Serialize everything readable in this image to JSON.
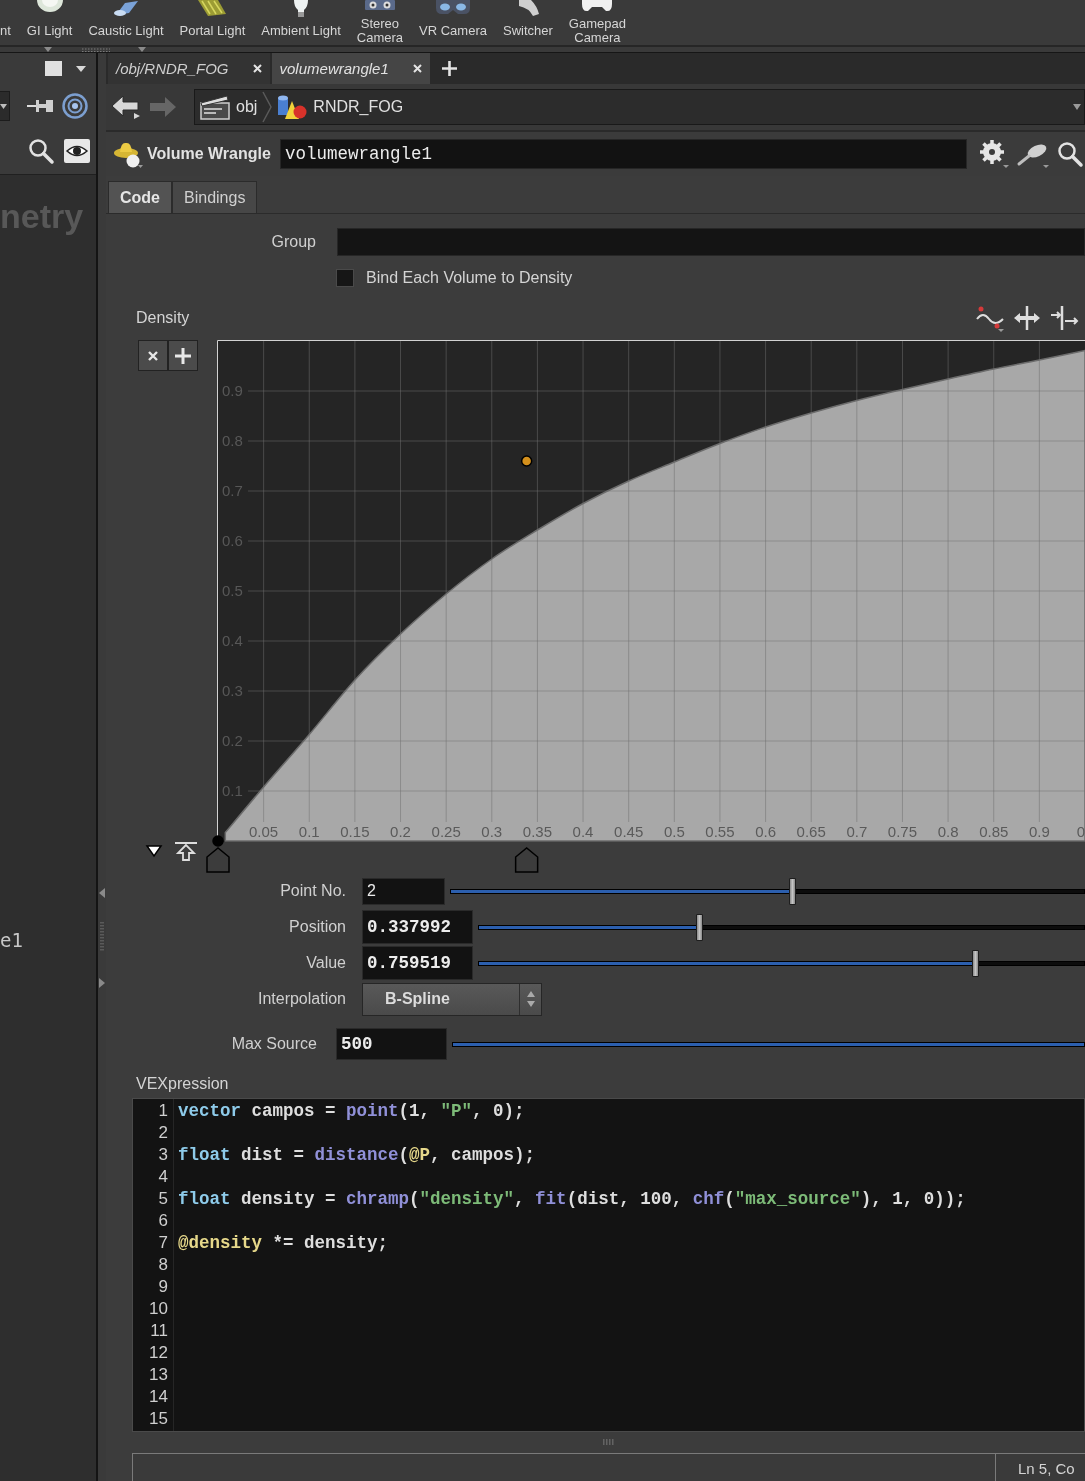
{
  "shelf": {
    "tools": [
      {
        "label": "nt",
        "kind": "none"
      },
      {
        "label": "GI Light",
        "kind": "sphere"
      },
      {
        "label": "Caustic Light",
        "kind": "spotlight"
      },
      {
        "label": "Portal Light",
        "kind": "portal"
      },
      {
        "label": "Ambient Light",
        "kind": "bulb"
      },
      {
        "label": "Stereo\nCamera",
        "kind": "stereo-camera"
      },
      {
        "label": "VR Camera",
        "kind": "vr-headset"
      },
      {
        "label": "Switcher",
        "kind": "switch"
      },
      {
        "label": "Gamepad\nCamera",
        "kind": "gamepad"
      }
    ]
  },
  "network_pane": {
    "title": "netry",
    "node_label": "e1"
  },
  "pane_tabs": [
    {
      "label": "/obj/RNDR_FOG",
      "selected": false
    },
    {
      "label": "volumewrangle1",
      "selected": true
    }
  ],
  "nav_buttons": [
    {
      "kind": "back",
      "disabled": false
    },
    {
      "kind": "forward",
      "disabled": true
    }
  ],
  "path": [
    {
      "label": "obj",
      "kind": "network"
    },
    {
      "label": "RNDR_FOG",
      "kind": "geometry"
    }
  ],
  "node": {
    "type_label": "Volume Wrangle",
    "name": "volumewrangle1"
  },
  "param_tabs": [
    {
      "label": "Code",
      "selected": true
    },
    {
      "label": "Bindings",
      "selected": false
    }
  ],
  "group": {
    "label": "Group"
  },
  "bind_each_volume": {
    "label": "Bind Each Volume to Density",
    "checked": false
  },
  "density": {
    "label": "Density",
    "chart_data": {
      "type": "area",
      "x": [
        0.008,
        0.05,
        0.1,
        0.15,
        0.2,
        0.25,
        0.3,
        0.35,
        0.4,
        0.45,
        0.5,
        0.55,
        0.6,
        0.65,
        0.7,
        0.75,
        0.8,
        0.85,
        0.9,
        0.95
      ],
      "values": [
        0.017,
        0.108,
        0.213,
        0.322,
        0.414,
        0.494,
        0.564,
        0.622,
        0.675,
        0.72,
        0.758,
        0.795,
        0.828,
        0.856,
        0.881,
        0.903,
        0.924,
        0.944,
        0.962,
        0.981
      ],
      "xlim": [
        0,
        0.95
      ],
      "ylim": [
        0,
        1
      ],
      "xticks": [
        0.05,
        0.1,
        0.15,
        0.2,
        0.25,
        0.3,
        0.35,
        0.4,
        0.45,
        0.5,
        0.55,
        0.6,
        0.65,
        0.7,
        0.75,
        0.8,
        0.85,
        0.9
      ],
      "yticks": [
        0.1,
        0.2,
        0.3,
        0.4,
        0.5,
        0.6,
        0.7,
        0.8,
        0.9
      ],
      "grid": true
    },
    "cut_tick_label": "0",
    "ramp_keys": [
      {
        "selected": false,
        "position": {
          "level": 0
        },
        "value": {
          "level": 0
        }
      },
      {
        "selected": true,
        "position": {
          "level": 0.356
        },
        "value": {
          "level": 0.76
        }
      }
    ],
    "fields": [
      {
        "kind": "int-slider",
        "label": "Point No.",
        "value": "2",
        "modified": false,
        "level": 0.54
      },
      {
        "kind": "float-slider",
        "label": "Position",
        "value": "0.337992",
        "modified": true,
        "level": 0.366
      },
      {
        "kind": "float-slider",
        "label": "Value",
        "value": "0.759519",
        "modified": true,
        "level": 0.821
      },
      {
        "kind": "menu",
        "label": "Interpolation",
        "value": "B-Spline",
        "modified": true
      }
    ]
  },
  "max_source": {
    "label": "Max Source",
    "value": "500",
    "modified": true,
    "level": 1
  },
  "vexpression": {
    "label": "VEXpression",
    "lines": [
      {
        "number": "1",
        "tokens": [
          {
            "kind": "type",
            "text": "vector"
          },
          {
            "kind": "plain",
            "text": " campos = "
          },
          {
            "kind": "func",
            "text": "point"
          },
          {
            "kind": "plain",
            "text": "(1, "
          },
          {
            "kind": "string",
            "text": "\"P\""
          },
          {
            "kind": "plain",
            "text": ", 0);"
          }
        ]
      },
      {
        "number": "2"
      },
      {
        "number": "3",
        "tokens": [
          {
            "kind": "type",
            "text": "float"
          },
          {
            "kind": "plain",
            "text": " dist = "
          },
          {
            "kind": "func",
            "text": "distance"
          },
          {
            "kind": "plain",
            "text": "("
          },
          {
            "kind": "attr",
            "text": "@P"
          },
          {
            "kind": "plain",
            "text": ", campos);"
          }
        ]
      },
      {
        "number": "4"
      },
      {
        "number": "5",
        "tokens": [
          {
            "kind": "type",
            "text": "float"
          },
          {
            "kind": "plain",
            "text": " density = "
          },
          {
            "kind": "func",
            "text": "chramp"
          },
          {
            "kind": "plain",
            "text": "("
          },
          {
            "kind": "string",
            "text": "\"density\""
          },
          {
            "kind": "plain",
            "text": ", "
          },
          {
            "kind": "func",
            "text": "fit"
          },
          {
            "kind": "plain",
            "text": "(dist, 100, "
          },
          {
            "kind": "func",
            "text": "chf"
          },
          {
            "kind": "plain",
            "text": "("
          },
          {
            "kind": "string",
            "text": "\"max_source\""
          },
          {
            "kind": "plain",
            "text": "), 1, 0));"
          }
        ]
      },
      {
        "number": "6"
      },
      {
        "number": "7",
        "tokens": [
          {
            "kind": "attr",
            "text": "@density"
          },
          {
            "kind": "plain",
            "text": " *= density;"
          }
        ]
      },
      {
        "number": "8"
      },
      {
        "number": "9"
      },
      {
        "number": "10"
      },
      {
        "number": "11"
      },
      {
        "number": "12"
      },
      {
        "number": "13"
      },
      {
        "number": "14"
      },
      {
        "number": "15"
      }
    ]
  },
  "status_bar": {
    "cursor": "Ln 5, Co"
  }
}
